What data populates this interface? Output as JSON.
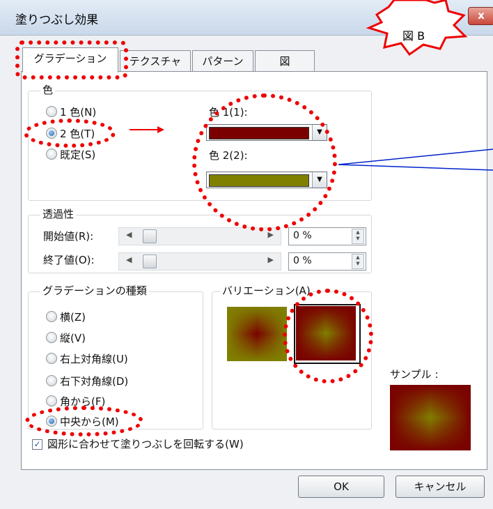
{
  "window": {
    "title": "塗りつぶし効果",
    "close_glyph": "x"
  },
  "callout": {
    "label": "図 B"
  },
  "tabs": [
    {
      "label": "グラデーション",
      "active": true
    },
    {
      "label": "テクスチャ",
      "active": false
    },
    {
      "label": "パターン",
      "active": false
    },
    {
      "label": "図",
      "active": false
    }
  ],
  "colors_group": {
    "title": "色",
    "options": [
      {
        "label": "1 色(N)",
        "selected": false
      },
      {
        "label": "2 色(T)",
        "selected": true
      },
      {
        "label": "既定(S)",
        "selected": false
      }
    ],
    "color1": {
      "label": "色 1(1):",
      "value": "#7a0000"
    },
    "color2": {
      "label": "色 2(2):",
      "value": "#808000"
    }
  },
  "transparency_group": {
    "title": "透過性",
    "start": {
      "label": "開始値(R):",
      "value": "0 %",
      "level": 0
    },
    "end": {
      "label": "終了値(O):",
      "value": "0 %",
      "level": 0
    }
  },
  "gradient_type_group": {
    "title": "グラデーションの種類",
    "options": [
      {
        "label": "横(Z)",
        "selected": false
      },
      {
        "label": "縦(V)",
        "selected": false
      },
      {
        "label": "右上対角線(U)",
        "selected": false
      },
      {
        "label": "右下対角線(D)",
        "selected": false
      },
      {
        "label": "角から(F)",
        "selected": false
      },
      {
        "label": "中央から(M)",
        "selected": true
      }
    ]
  },
  "variation_group": {
    "title": "バリエーション(A)",
    "selected_index": 1
  },
  "sample": {
    "label": "サンプル :"
  },
  "rotate_checkbox": {
    "label": "図形に合わせて塗りつぶしを回転する(W)",
    "checked": true,
    "check_glyph": "✓"
  },
  "buttons": {
    "ok": "OK",
    "cancel": "キャンセル"
  },
  "annotation_colors": {
    "highlight": "#ee0000",
    "callout_line": "#0022cc"
  }
}
